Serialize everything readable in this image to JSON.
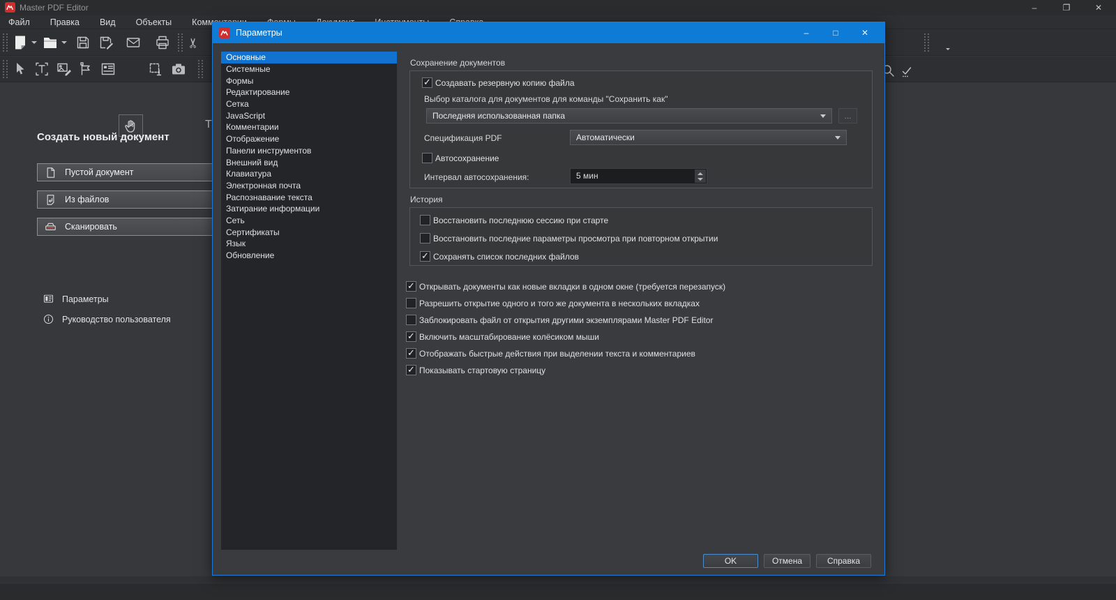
{
  "colors": {
    "accent_blue": "#0e7cd7",
    "selection_blue": "#1173cf",
    "logo_red": "#cf2e2e",
    "scanner_line_red": "#cf5a5a"
  },
  "window": {
    "title": "Master PDF Editor",
    "controls": {
      "minimize": "–",
      "restore": "❐",
      "close": "✕"
    }
  },
  "menubar": {
    "items": [
      "Файл",
      "Правка",
      "Вид",
      "Объекты",
      "Комментарии",
      "Формы",
      "Документ",
      "Инструменты",
      "Справка"
    ]
  },
  "toolbars": {
    "file": [
      "new-document",
      "open-folder",
      "save",
      "save-as",
      "email",
      "print",
      "cut"
    ],
    "tools": [
      "select",
      "edit-text",
      "edit-image",
      "edit-forms",
      "manage-forms",
      "hand",
      "select-region",
      "snapshot",
      "add-text"
    ],
    "right": [
      "zoom-combobox",
      "main-menu",
      "search",
      "validate"
    ],
    "active_tool": "hand"
  },
  "start_page": {
    "heading": "Создать новый документ",
    "buttons": [
      {
        "label": "Пустой документ",
        "icon": "blank-document"
      },
      {
        "label": "Из файлов",
        "icon": "from-files"
      },
      {
        "label": "Сканировать",
        "icon": "scanner"
      }
    ],
    "links": [
      {
        "label": "Параметры",
        "icon": "settings"
      },
      {
        "label": "Руководство пользователя",
        "icon": "info"
      }
    ]
  },
  "dialog": {
    "title": "Параметры",
    "controls": {
      "minimize": "–",
      "maximize": "□",
      "close": "✕"
    },
    "sidebar": {
      "selected": "Основные",
      "items": [
        "Основные",
        "Системные",
        "Формы",
        "Редактирование",
        "Сетка",
        "JavaScript",
        "Комментарии",
        "Отображение",
        "Панели инструментов",
        "Внешний вид",
        "Клавиатура",
        "Электронная почта",
        "Распознавание текста",
        "Затирание информации",
        "Сеть",
        "Сертификаты",
        "Язык",
        "Обновление"
      ]
    },
    "saving_group": {
      "title": "Сохранение документов",
      "backup": {
        "label": "Создавать резервную копию файла",
        "checked": true
      },
      "dir_label": "Выбор каталога для документов для команды \"Сохранить как\"",
      "dir_value": "Последняя использованная папка",
      "browse_label": "...",
      "spec_label": "Спецификация PDF",
      "spec_value": "Автоматически",
      "autosave": {
        "label": "Автосохранение",
        "checked": false
      },
      "interval_label": "Интервал автосохранения:",
      "interval_value": "5 мин"
    },
    "history_group": {
      "title": "История",
      "rows": [
        {
          "label": "Восстановить последнюю сессию при старте",
          "checked": false
        },
        {
          "label": "Восстановить последние параметры просмотра при повторном открытии",
          "checked": false
        },
        {
          "label": "Сохранять список последних файлов",
          "checked": true
        }
      ]
    },
    "options": [
      {
        "label": "Открывать документы как новые вкладки в одном окне (требуется перезапуск)",
        "checked": true
      },
      {
        "label": "Разрешить открытие одного и того же документа в нескольких вкладках",
        "checked": false
      },
      {
        "label": "Заблокировать файл от открытия другими экземплярами Master PDF Editor",
        "checked": false
      },
      {
        "label": "Включить масштабирование колёсиком мыши",
        "checked": true
      },
      {
        "label": "Отображать быстрые действия при выделении текста и комментариев",
        "checked": true
      },
      {
        "label": "Показывать стартовую страницу",
        "checked": true
      }
    ],
    "buttons": {
      "ok": "OK",
      "cancel": "Отмена",
      "help": "Справка"
    }
  }
}
